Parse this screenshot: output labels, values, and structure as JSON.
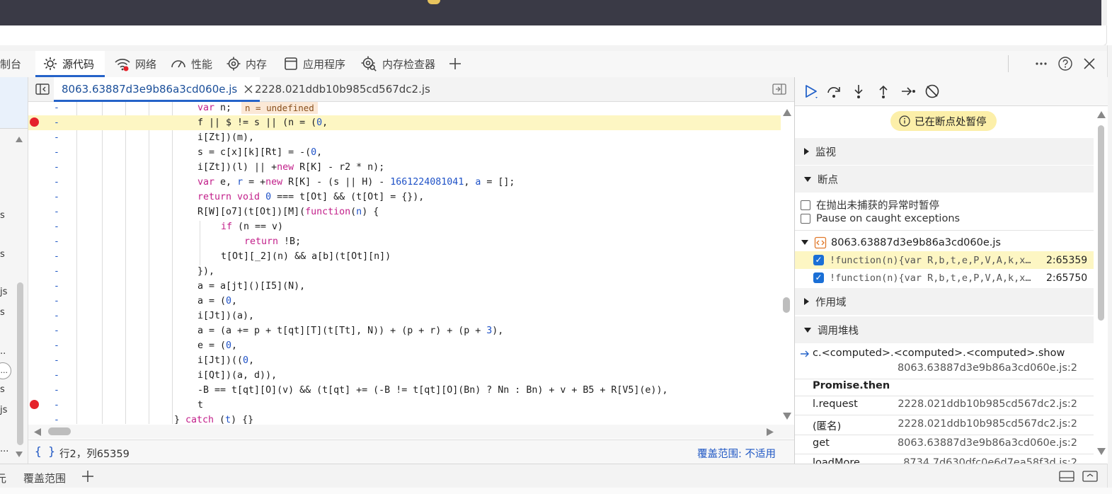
{
  "devtools_tabs": [
    {
      "label": "制台",
      "icon": "console-icon"
    },
    {
      "label": "源代码",
      "icon": "sources-icon",
      "active": true
    },
    {
      "label": "网络",
      "icon": "wifi-icon"
    },
    {
      "label": "性能",
      "icon": "performance-icon"
    },
    {
      "label": "内存",
      "icon": "memory-chip-icon"
    },
    {
      "label": "应用程序",
      "icon": "application-icon"
    },
    {
      "label": "内存检查器",
      "icon": "memory-inspector-icon"
    }
  ],
  "left_strip_fragments": [
    "s",
    "s",
    "js",
    "s",
    "..",
    "s",
    "js",
    "..."
  ],
  "file_tabs": [
    {
      "label": "8063.63887d3e9b86a3cd060e.js",
      "active": true
    },
    {
      "label": "2228.021ddb10b985cd567dc2.js",
      "active": false
    }
  ],
  "editor": {
    "gutter_mark": "-",
    "inline_value": "n = undefined",
    "lines": [
      {
        "indent": 6,
        "html": "<span class=\"k\">var</span> n;"
      },
      {
        "indent": 6,
        "html": "f || $ != s || (n = (<span class=\"n\">0</span>,",
        "highlight": true,
        "breakpoint": true
      },
      {
        "indent": 6,
        "html": "i[Zt])(m),"
      },
      {
        "indent": 6,
        "html": "s = c[x][k][Rt] = -(<span class=\"n\">0</span>,"
      },
      {
        "indent": 6,
        "html": "i[Zt])(l) || +<span class=\"k\">new</span> R[K] - r2 * n);"
      },
      {
        "indent": 6,
        "html": "<span class=\"k\">var</span> e, <span class=\"n\">r</span> = +<span class=\"k\">new</span> R[K] - (s || H) - <span class=\"n\">1661224081041</span>, <span class=\"n\">a</span> = [];"
      },
      {
        "indent": 6,
        "html": "<span class=\"k\">return void</span> <span class=\"n\">0</span> === t[Ot] && (t[Ot] = {}),"
      },
      {
        "indent": 6,
        "html": "R[W][o7](t[Ot])[M](<span class=\"k\">function</span>(<span class=\"n\">n</span>) {"
      },
      {
        "indent": 7,
        "html": "<span class=\"k\">if</span> (n == v)"
      },
      {
        "indent": 8,
        "html": "<span class=\"k\">return</span> !B;"
      },
      {
        "indent": 7,
        "html": "t[Ot][_2](n) && a[b](t[Ot][n])"
      },
      {
        "indent": 6,
        "html": "}),"
      },
      {
        "indent": 6,
        "html": "a = a[jt]()[I5](N),"
      },
      {
        "indent": 6,
        "html": "a = (<span class=\"n\">0</span>,"
      },
      {
        "indent": 6,
        "html": "i[Jt])(a),"
      },
      {
        "indent": 6,
        "html": "a = (a += p + t[qt][T](t[Tt], N)) + (p + r) + (p + <span class=\"n\">3</span>),"
      },
      {
        "indent": 6,
        "html": "e = (<span class=\"n\">0</span>,"
      },
      {
        "indent": 6,
        "html": "i[Jt])((<span class=\"n\">0</span>,"
      },
      {
        "indent": 6,
        "html": "i[Qt])(a, d)),"
      },
      {
        "indent": 6,
        "html": "-B == t[qt][O](v) && (t[qt] += (-B != t[qt][O](Bn) ? Nn : Bn) + v + B5 + R[V5](e)),"
      },
      {
        "indent": 6,
        "html": "t",
        "breakpoint": true
      },
      {
        "indent": 5,
        "html": "} <span class=\"k\">catch</span> (<span class=\"n\">t</span>) {}"
      }
    ]
  },
  "status": {
    "braces": "{ }",
    "position": "行2，列65359",
    "coverage": "覆盖范围: 不适用"
  },
  "debugger": {
    "paused_text": "已在断点处暂停",
    "sections": {
      "watch": "监视",
      "breakpoints": "断点",
      "scope": "作用域",
      "call_stack": "调用堆栈"
    },
    "pause_uncaught": "在抛出未捕获的异常时暂停",
    "pause_caught": "Pause on caught exceptions",
    "bp_file": "8063.63887d3e9b86a3cd060e.js",
    "breakpoint_items": [
      {
        "code": "!function(n){var R,b,t,e,P,V,A,k,x…",
        "loc": "2:65359",
        "active": true
      },
      {
        "code": "!function(n){var R,b,t,e,P,V,A,k,x…",
        "loc": "2:65750",
        "active": false
      }
    ],
    "call_stack_current": {
      "fn": "c.<computed>.<computed>.<computed>.show",
      "src": "8063.63887d3e9b86a3cd060e.js:2"
    },
    "async_label": "Promise.then",
    "frames": [
      {
        "fn": "l.request",
        "src": "2228.021ddb10b985cd567dc2.js:2"
      },
      {
        "fn": "(匿名)",
        "src": "2228.021ddb10b985cd567dc2.js:2"
      },
      {
        "fn": "get",
        "src": "8063.63887d3e9b86a3cd060e.js:2"
      },
      {
        "fn": "loadMore",
        "src": "8734.7d630dfc0e6d7ea58f3d.js:2"
      }
    ]
  },
  "drawer": {
    "tabs": [
      "元",
      "覆盖范围"
    ]
  },
  "colors": {
    "accent": "#2563c9",
    "breakpoint": "#e5222a",
    "highlight_line": "#fdf6c3",
    "keyword": "#c21f8a",
    "number": "#1f52c7"
  }
}
